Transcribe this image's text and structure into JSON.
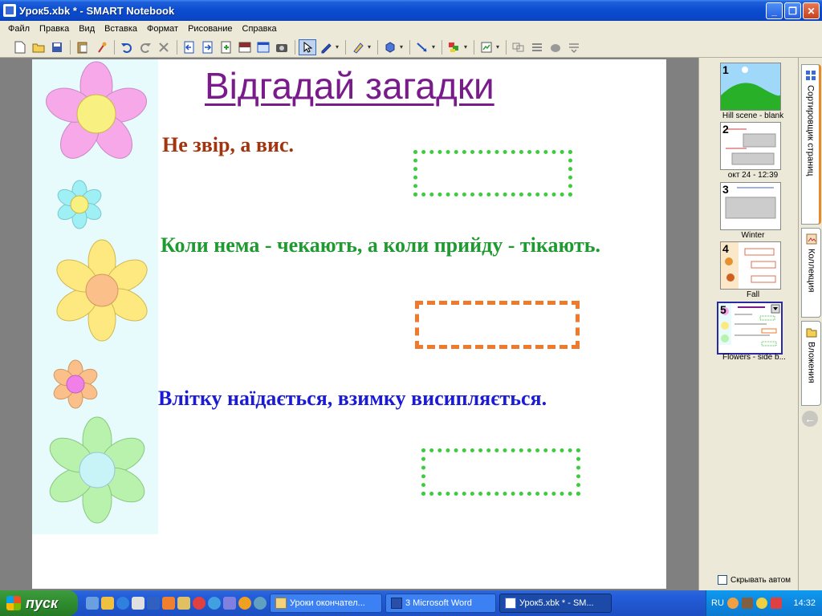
{
  "window": {
    "title": "Урок5.xbk * - SMART Notebook",
    "minimize": "_",
    "restore": "❐",
    "close": "✕"
  },
  "menu": [
    "Файл",
    "Правка",
    "Вид",
    "Вставка",
    "Формат",
    "Рисование",
    "Справка"
  ],
  "toolbar": {
    "icons": [
      "new-icon",
      "open-icon",
      "save-icon",
      "paste-icon",
      "attach-icon",
      "undo-icon",
      "redo-icon",
      "delete-icon",
      "prev-page-icon",
      "next-page-icon",
      "add-page-icon",
      "screen-shade-icon",
      "full-screen-icon",
      "camera-icon",
      "select-icon",
      "pen-icon",
      "highlighter-icon",
      "shapes-icon",
      "line-icon",
      "fill-icon",
      "properties-icon",
      "group-icon",
      "order-icon",
      "eraser-icon",
      "more-icon"
    ]
  },
  "canvas": {
    "title": "Відгадай загадки",
    "riddle1": "Не звір, а вис.",
    "riddle2": "Коли нема - чекають, а коли прийду - тікають.",
    "riddle3": "Влітку наїдається, взимку висипляється.",
    "flower_colors": [
      "#f6a8e8",
      "#9ff0f4",
      "#fde980",
      "#fbc08a",
      "#b8f2ac"
    ]
  },
  "sidepanel": {
    "pages": [
      {
        "num": "1",
        "label": "Hill scene - blank"
      },
      {
        "num": "2",
        "label": "окт 24 - 12:39"
      },
      {
        "num": "3",
        "label": "Winter"
      },
      {
        "num": "4",
        "label": "Fall"
      },
      {
        "num": "5",
        "label": "Flowers - side b..."
      }
    ],
    "hide_auto": "Скрывать автом"
  },
  "sidetabs": {
    "page_sorter": "Сортировщик страниц",
    "gallery": "Коллекция",
    "attachments": "Вложения"
  },
  "taskbar": {
    "start": "пуск",
    "tasks": [
      "Уроки окончател...",
      "3 Microsoft Word",
      "Урок5.xbk * - SM..."
    ],
    "lang": "RU",
    "clock": "14:32"
  }
}
